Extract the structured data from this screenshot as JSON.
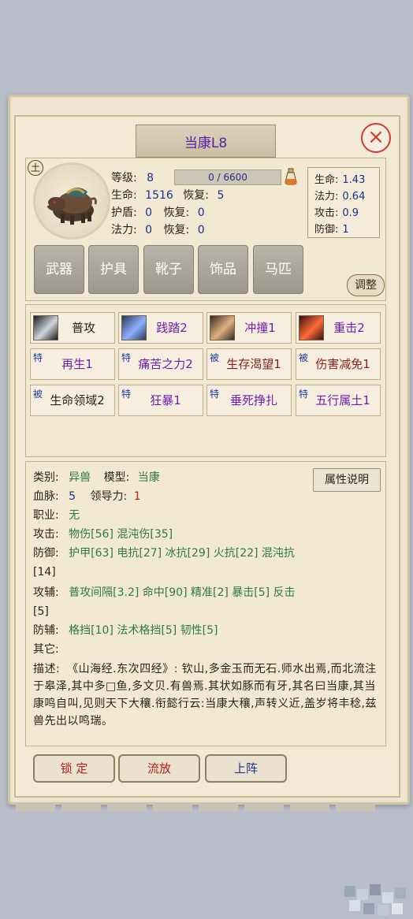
{
  "window": {
    "title": "当康L8",
    "close_glyph": "×"
  },
  "pet": {
    "element_badge": "土",
    "level_label": "等级:",
    "level": "8",
    "xp_text": "0 / 6600",
    "xp_fraction": 0.0,
    "hp_label": "生命:",
    "hp": "1516",
    "regen1_label": "恢复:",
    "regen1": "5",
    "shield_label": "护盾:",
    "shield": "0",
    "regen2_label": "恢复:",
    "regen2": "0",
    "mana_label": "法力:",
    "mana": "0",
    "regen3_label": "恢复:",
    "regen3": "0"
  },
  "growth": [
    {
      "label": "生命:",
      "value": "1.43"
    },
    {
      "label": "法力:",
      "value": "0.64"
    },
    {
      "label": "攻击:",
      "value": "0.9"
    },
    {
      "label": "防御:",
      "value": "1"
    }
  ],
  "equipment": [
    "武器",
    "护具",
    "靴子",
    "饰品",
    "马匹"
  ],
  "adjust_label": "调整",
  "skills": [
    {
      "tag": "",
      "name": "普攻",
      "style": "dark",
      "icon": "sword-icon"
    },
    {
      "tag": "",
      "name": "践踏2",
      "style": "purple",
      "icon": "stomp-icon"
    },
    {
      "tag": "",
      "name": "冲撞1",
      "style": "purple",
      "icon": "charge-icon"
    },
    {
      "tag": "",
      "name": "重击2",
      "style": "purple",
      "icon": "heavy-strike-icon"
    },
    {
      "tag": "特",
      "name": "再生1",
      "style": "purple"
    },
    {
      "tag": "特",
      "name": "痛苦之力2",
      "style": "purple"
    },
    {
      "tag": "被",
      "name": "生存渴望1",
      "style": "red"
    },
    {
      "tag": "被",
      "name": "伤害减免1",
      "style": "red"
    },
    {
      "tag": "被",
      "name": "生命领域2",
      "style": "dark"
    },
    {
      "tag": "特",
      "name": "狂暴1",
      "style": "purple"
    },
    {
      "tag": "特",
      "name": "垂死挣扎",
      "style": "purple"
    },
    {
      "tag": "特",
      "name": "五行属土1",
      "style": "purple"
    }
  ],
  "info": {
    "type_label": "类别:",
    "type": "异兽",
    "model_label": "模型:",
    "model": "当康",
    "blood_label": "血脉:",
    "blood": "5",
    "lead_label": "领导力:",
    "lead": "1",
    "job_label": "职业:",
    "job": "无",
    "attack_label": "攻击:",
    "attack": "物伤[56] 混沌伤[35]",
    "defense_label": "防御:",
    "defense_1": "护甲[63] 电抗[27] 冰抗[29] 火抗[22] 混沌抗",
    "defense_2": "[14]",
    "atkaux_label": "攻辅:",
    "atkaux_1": "普攻间隔[3.2] 命中[90] 精准[2] 暴击[5] 反击",
    "atkaux_2": "[5]",
    "defaux_label": "防辅:",
    "defaux": "格挡[10] 法术格挡[5] 韧性[5]",
    "other_label": "其它:",
    "desc_label": "描述:",
    "desc": "《山海经.东次四经》: 钦山,多金玉而无石.师水出焉,而北流注于皋泽,其中多□鱼,多文贝.有兽焉.其状如豚而有牙,其名曰当康,其当 康鸣自叫,见则天下大穰.衔懿行云:当康大穰,声转义近,盖岁将丰稔,兹兽先出以鸣瑞。",
    "help_button": "属性说明"
  },
  "buttons": {
    "lock": "锁 定",
    "release": "流放",
    "deploy": "上阵"
  },
  "colors": {
    "purple": "#6e1fb0",
    "red": "#8e1d1d",
    "blue": "#1c2f8e",
    "close": "#d23a2e"
  }
}
